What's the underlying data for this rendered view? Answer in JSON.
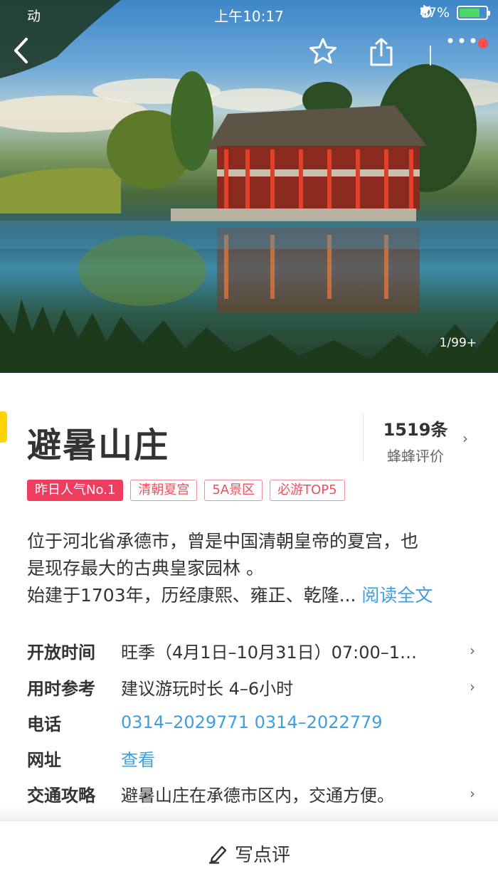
{
  "status_bar": {
    "carrier": "动",
    "time": "上午10:17",
    "battery_percent": "77%",
    "battery_level": 0.77
  },
  "hero": {
    "photo_counter": "1/99+"
  },
  "header": {
    "back_icon": "chevron-left-icon",
    "favorite_icon": "star-icon",
    "share_icon": "share-icon",
    "more_icon": "more-dots-icon",
    "notification_dot_color": "#ff4d4f"
  },
  "attraction": {
    "name": "避暑山庄",
    "review_count": "1519条",
    "review_label": "蜂蜂评价",
    "tags": [
      {
        "label": "昨日人气No.1",
        "primary": true
      },
      {
        "label": "清朝夏宫",
        "primary": false
      },
      {
        "label": "5A景区",
        "primary": false
      },
      {
        "label": "必游TOP5",
        "primary": false
      }
    ],
    "description": {
      "line1": "位于河北省承德市，曾是中国清朝皇帝的夏宫，也",
      "line2": "是现存最大的古典皇家园林 。",
      "line3": "始建于1703年，历经康熙、雍正、乾隆...",
      "read_more": "阅读全文"
    }
  },
  "info": {
    "hours": {
      "label": "开放时间",
      "value": "旺季（4月1日–10月31日）07:00–1…"
    },
    "duration": {
      "label": "用时参考",
      "value": "建议游玩时长 4–6小时"
    },
    "phone": {
      "label": "电话",
      "value": "0314–2029771 0314–2022779"
    },
    "website": {
      "label": "网址",
      "value": "查看"
    },
    "transport": {
      "label": "交通攻略",
      "value": "避暑山庄在承德市区内，交通方便。"
    }
  },
  "bottom_bar": {
    "write_review": "写点评",
    "icon": "pen-icon"
  },
  "colors": {
    "accent_blue": "#3d9ee0",
    "tag_red": "#ef4f5c",
    "primary_tag_bg": "#ee3d5f",
    "brand_yellow": "#ffd200"
  }
}
